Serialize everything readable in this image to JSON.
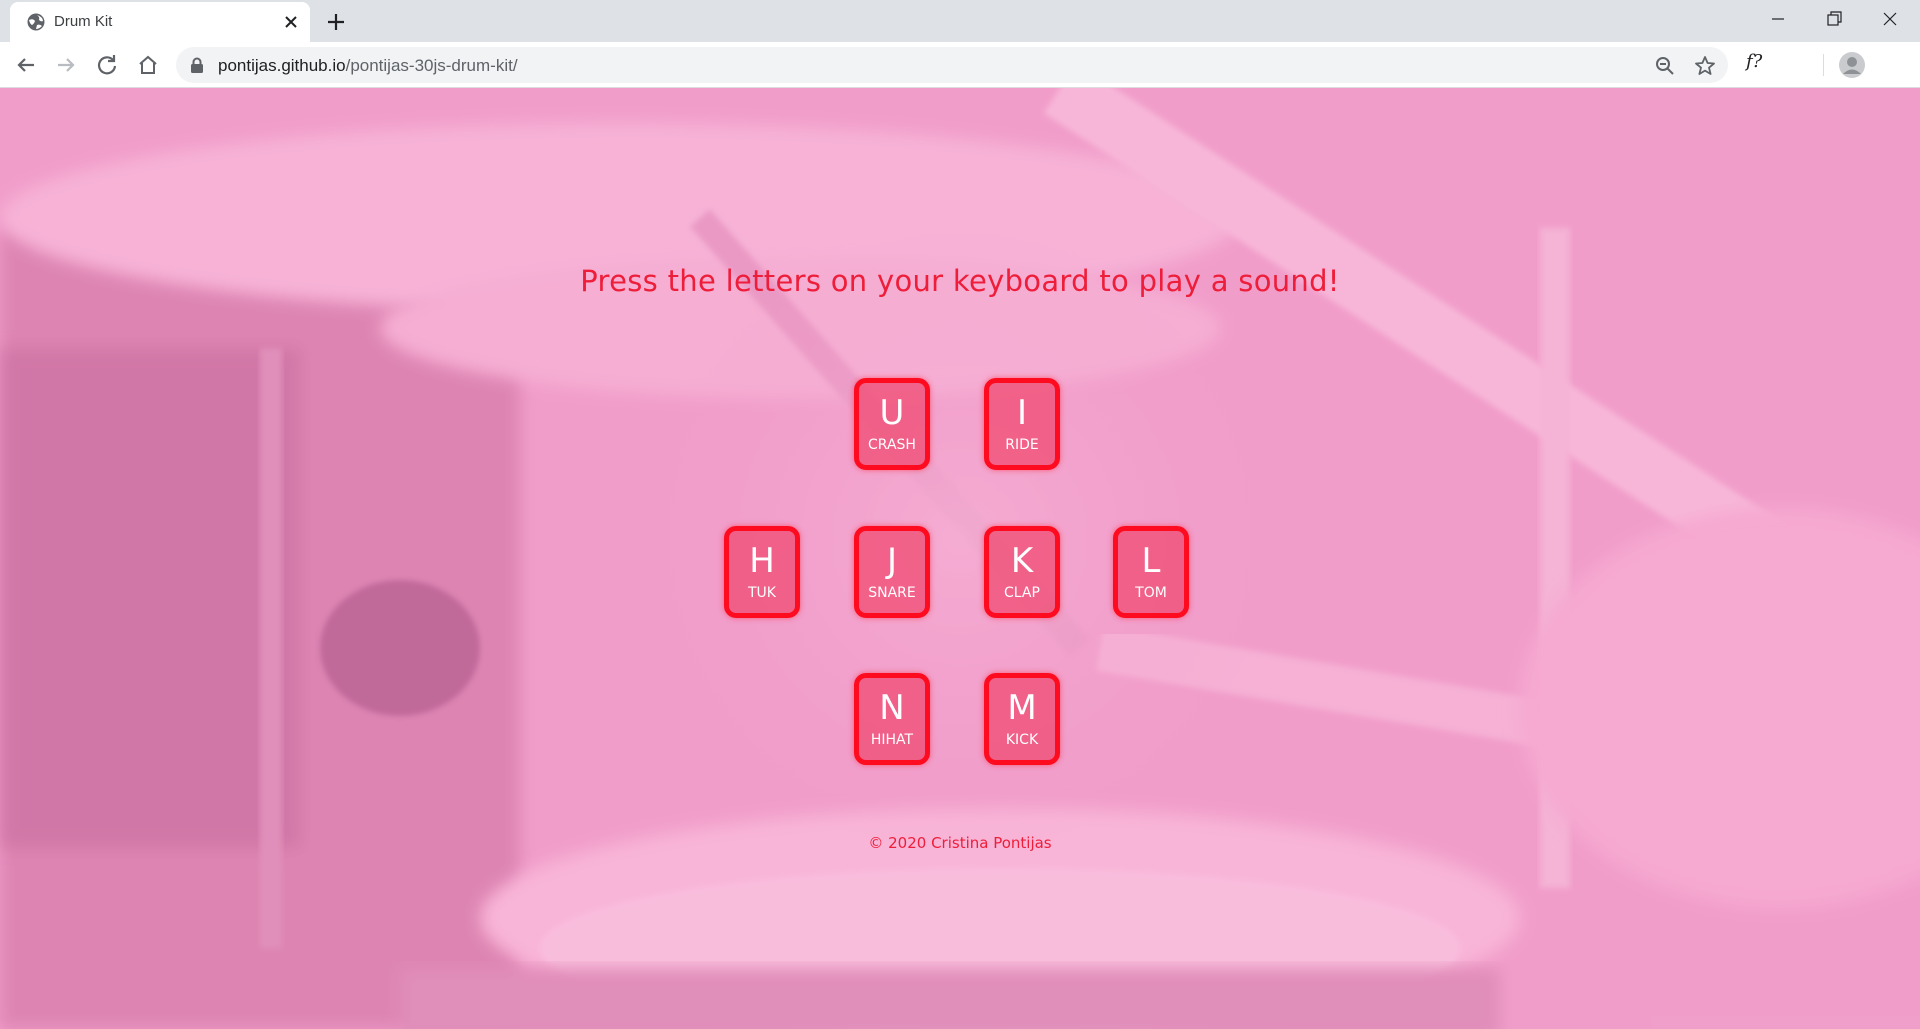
{
  "browser": {
    "tab_title": "Drum Kit",
    "url_host": "pontijas.github.io",
    "url_path": "/pontijas-30js-drum-kit/",
    "extension_label": "f?"
  },
  "page": {
    "headline": "Press the letters on your keyboard to play a sound!",
    "footer": "© 2020 Cristina Pontijas",
    "keys": [
      {
        "letter": "U",
        "sound": "CRASH"
      },
      {
        "letter": "I",
        "sound": "RIDE"
      },
      {
        "letter": "H",
        "sound": "TUK"
      },
      {
        "letter": "J",
        "sound": "SNARE"
      },
      {
        "letter": "K",
        "sound": "CLAP"
      },
      {
        "letter": "L",
        "sound": "TOM"
      },
      {
        "letter": "N",
        "sound": "HIHAT"
      },
      {
        "letter": "M",
        "sound": "KICK"
      }
    ]
  },
  "colors": {
    "accent": "#ee1d39",
    "key_border": "#ff0b1f",
    "background_tint": "#f0a6cf"
  },
  "icons": [
    "globe-icon",
    "close-icon",
    "plus-icon",
    "minimize-icon",
    "restore-icon",
    "window-close-icon",
    "back-icon",
    "forward-icon",
    "reload-icon",
    "home-icon",
    "lock-icon",
    "zoom-icon",
    "star-icon",
    "profile-icon"
  ]
}
